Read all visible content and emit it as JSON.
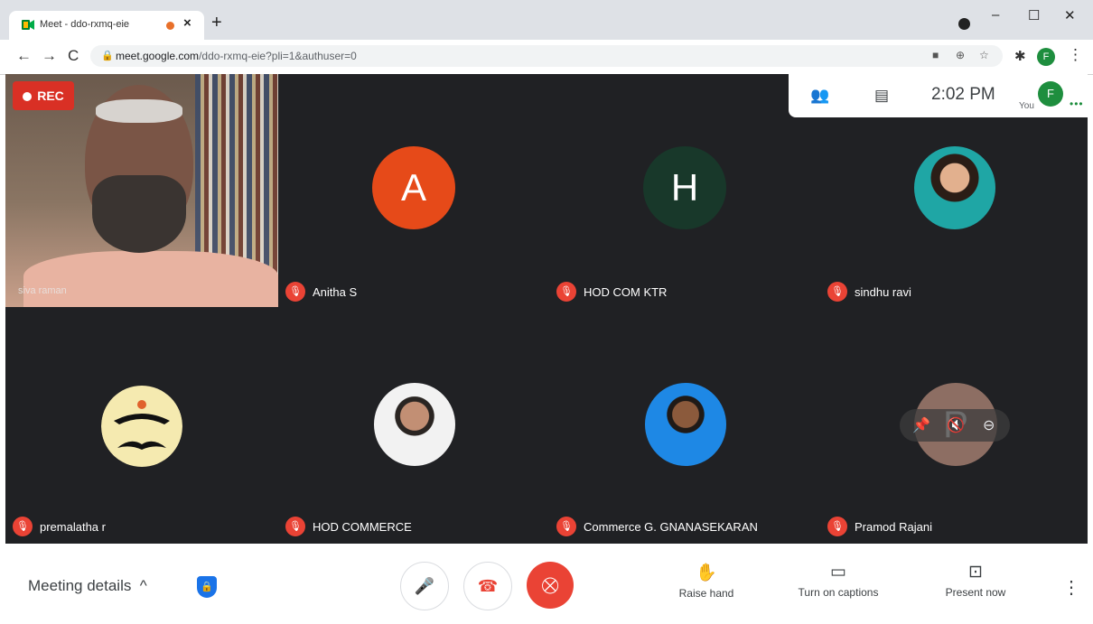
{
  "browser": {
    "tab_title": "Meet - ddo-rxmq-eie",
    "tab_close": "×",
    "new_tab": "+",
    "url_host": "meet.google.com",
    "url_path": "/ddo-rxmq-eie?pli=1&authuser=0",
    "profile_initial": "F",
    "window": {
      "minimize": "–",
      "maximize": "☐",
      "close": "✕"
    },
    "nav": {
      "back": "←",
      "forward": "→",
      "reload": "C"
    }
  },
  "meet": {
    "rec_label": "REC",
    "time": "2:02 PM",
    "you_label": "You",
    "you_initial": "F",
    "self_name": "siva raman",
    "participants": [
      {
        "name": "Anitha S",
        "initial": "A",
        "color": "#e64a19"
      },
      {
        "name": "HOD COM KTR",
        "initial": "H",
        "color": "#18382a"
      },
      {
        "name": "sindhu ravi"
      },
      {
        "name": "premalatha r"
      },
      {
        "name": "HOD COMMERCE"
      },
      {
        "name": "Commerce G. GNANASEKARAN"
      },
      {
        "name": "Pramod Rajani",
        "initial": "P",
        "color": "#8d6e63"
      }
    ]
  },
  "bottom": {
    "meeting_details": "Meeting details",
    "chevron": "^",
    "raise_hand": "Raise hand",
    "captions": "Turn on captions",
    "present": "Present now"
  },
  "colors": {
    "accent_red": "#ea4335",
    "tile_bg": "#202124",
    "brand_blue": "#1a73e8",
    "brand_green": "#1e8e3e"
  }
}
